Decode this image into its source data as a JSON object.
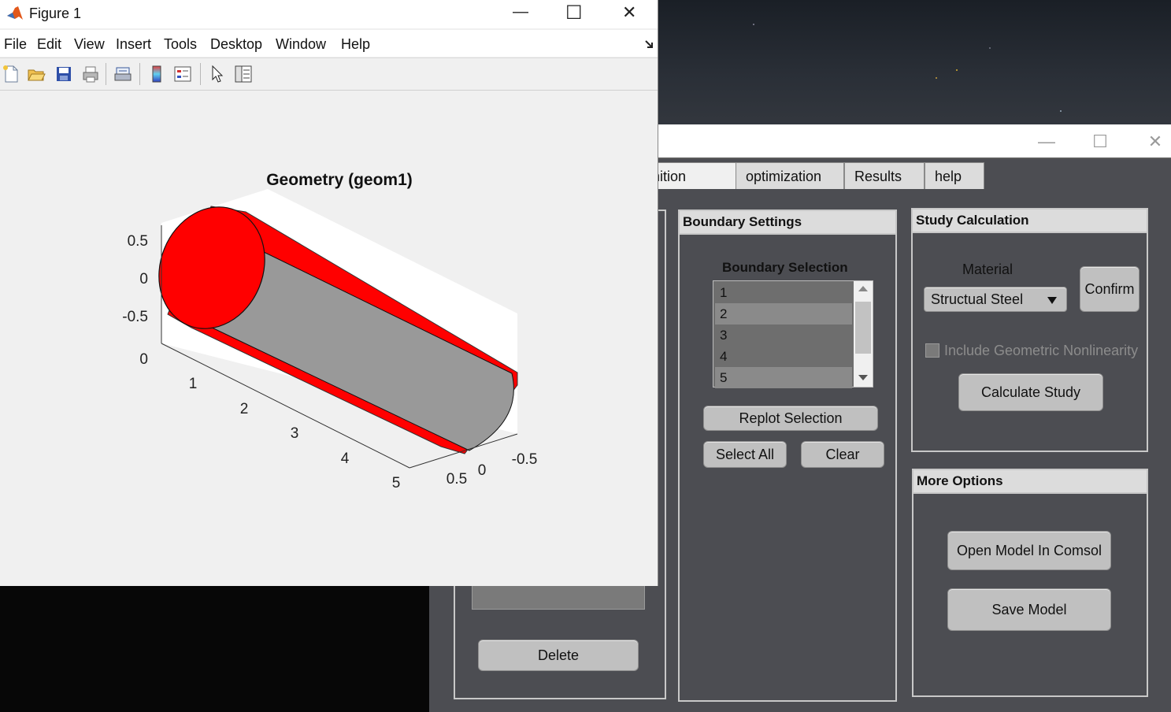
{
  "figure_window": {
    "title": "Figure 1",
    "controls": {
      "minimize": "—",
      "maximize": "☐",
      "close": "✕"
    },
    "menu": [
      "File",
      "Edit",
      "View",
      "Insert",
      "Tools",
      "Desktop",
      "Window",
      "Help"
    ],
    "toolbar_icons": [
      "new-file-icon",
      "open-folder-icon",
      "save-icon",
      "print-icon",
      "print-preview-icon",
      "colorbar-icon",
      "legend-icon",
      "pointer-icon",
      "property-editor-icon"
    ]
  },
  "plot": {
    "title": "Geometry (geom1)",
    "z_ticks": [
      "0.5",
      "0",
      "-0.5",
      "0"
    ],
    "x_ticks": [
      "1",
      "2",
      "3",
      "4",
      "5"
    ],
    "y_ticks": [
      "0.5",
      "0",
      "-0.5"
    ],
    "colors": {
      "end_cap": "#ff0000",
      "body": "#999999",
      "axes_background": "#ffffff"
    }
  },
  "app": {
    "controls": {
      "minimize": "—",
      "maximize": "☐",
      "close": "✕"
    },
    "tabs": [
      {
        "label": "Definition",
        "active": true
      },
      {
        "label": "optimization"
      },
      {
        "label": "Results"
      },
      {
        "label": "help"
      }
    ],
    "boundary_settings": {
      "title": "Boundary Settings",
      "selection_label": "Boundary Selection",
      "items": [
        "1",
        "2",
        "3",
        "4",
        "5"
      ],
      "replot": "Replot Selection",
      "select_all": "Select All",
      "clear": "Clear"
    },
    "study_calculation": {
      "title": "Study Calculation",
      "material_label": "Material",
      "material_value": "Structual Steel",
      "confirm": "Confirm",
      "nonlinearity_label": "Include Geometric Nonlinearity",
      "calculate": "Calculate Study"
    },
    "more_options": {
      "title": "More Options",
      "open_comsol": "Open Model In Comsol",
      "save_model": "Save Model"
    },
    "left_panel": {
      "delete": "Delete"
    }
  }
}
